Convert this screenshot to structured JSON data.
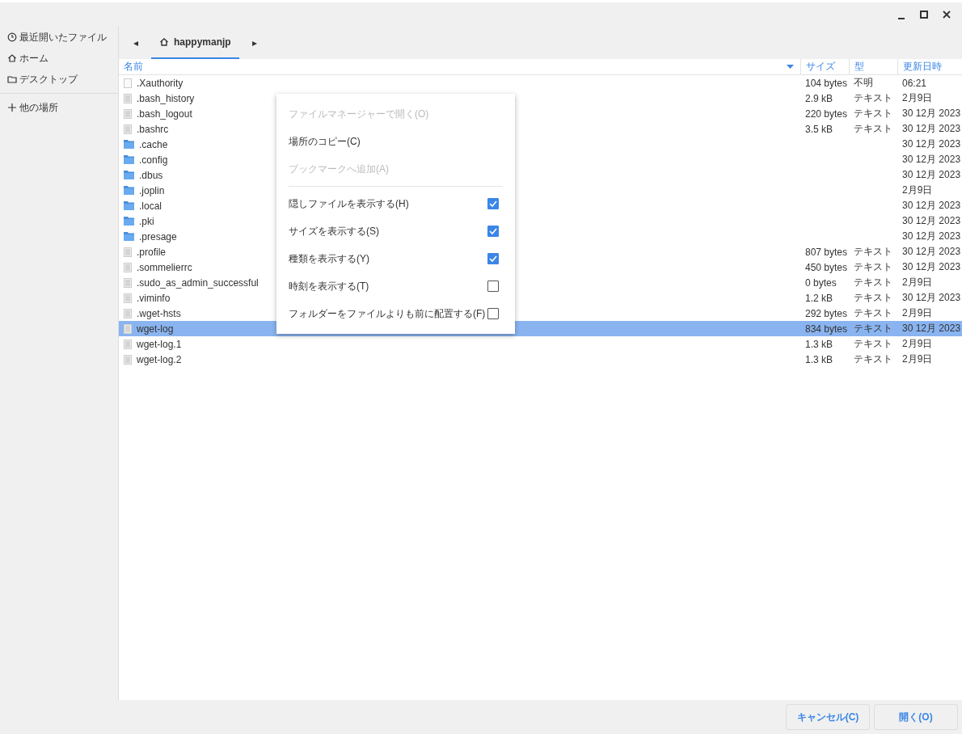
{
  "sidebar": {
    "items": [
      {
        "label": "最近開いたファイル",
        "selected": false
      },
      {
        "label": "ホーム",
        "selected": false
      },
      {
        "label": "デスクトップ",
        "selected": false
      }
    ],
    "other": {
      "label": "他の場所"
    }
  },
  "path_bar": {
    "back": "◂",
    "forward": "▸",
    "crumbs": [
      {
        "label": "happymanjp",
        "selected": true
      }
    ]
  },
  "table": {
    "columns": [
      "名前",
      "サイズ",
      "型",
      "更新日時"
    ],
    "rows": [
      {
        "kind": "unknown",
        "name": ".Xauthority",
        "size": "104 bytes",
        "type": "不明",
        "modified": "06:21",
        "selected": false
      },
      {
        "kind": "text",
        "name": ".bash_history",
        "size": "2.9 kB",
        "type": "テキスト",
        "modified": "2月9日",
        "selected": false
      },
      {
        "kind": "text",
        "name": ".bash_logout",
        "size": "220 bytes",
        "type": "テキスト",
        "modified": "30 12月 2023",
        "selected": false
      },
      {
        "kind": "text",
        "name": ".bashrc",
        "size": "3.5 kB",
        "type": "テキスト",
        "modified": "30 12月 2023",
        "selected": false
      },
      {
        "kind": "folder",
        "name": ".cache",
        "modified": "30 12月 2023",
        "selected": false
      },
      {
        "kind": "folder",
        "name": ".config",
        "modified": "30 12月 2023",
        "selected": false
      },
      {
        "kind": "folder",
        "name": ".dbus",
        "modified": "30 12月 2023",
        "selected": false
      },
      {
        "kind": "folder",
        "name": ".joplin",
        "modified": "2月9日",
        "selected": false
      },
      {
        "kind": "folder",
        "name": ".local",
        "modified": "30 12月 2023",
        "selected": false
      },
      {
        "kind": "folder",
        "name": ".pki",
        "modified": "30 12月 2023",
        "selected": false
      },
      {
        "kind": "folder",
        "name": ".presage",
        "modified": "30 12月 2023",
        "selected": false
      },
      {
        "kind": "text",
        "name": ".profile",
        "size": "807 bytes",
        "type": "テキスト",
        "modified": "30 12月 2023",
        "selected": false
      },
      {
        "kind": "text",
        "name": ".sommelierrc",
        "size": "450 bytes",
        "type": "テキスト",
        "modified": "30 12月 2023",
        "selected": false
      },
      {
        "kind": "text",
        "name": ".sudo_as_admin_successful",
        "size": "0 bytes",
        "type": "テキスト",
        "modified": "2月9日",
        "selected": false
      },
      {
        "kind": "text",
        "name": ".viminfo",
        "size": "1.2 kB",
        "type": "テキスト",
        "modified": "30 12月 2023",
        "selected": false
      },
      {
        "kind": "text",
        "name": ".wget-hsts",
        "size": "292 bytes",
        "type": "テキスト",
        "modified": "2月9日",
        "selected": false
      },
      {
        "kind": "text",
        "name": "wget-log",
        "size": "834 bytes",
        "type": "テキスト",
        "modified": "30 12月 2023",
        "selected": true
      },
      {
        "kind": "text",
        "name": "wget-log.1",
        "size": "1.3 kB",
        "type": "テキスト",
        "modified": "2月9日",
        "selected": false
      },
      {
        "kind": "text",
        "name": "wget-log.2",
        "size": "1.3 kB",
        "type": "テキスト",
        "modified": "2月9日",
        "selected": false
      }
    ]
  },
  "context_menu": {
    "items": [
      {
        "kind": "action",
        "label": "ファイルマネージャーで開く(O)",
        "disabled": true
      },
      {
        "kind": "action",
        "label": "場所のコピー(C)",
        "disabled": false
      },
      {
        "kind": "action",
        "label": "ブックマークへ追加(A)",
        "disabled": true
      },
      {
        "kind": "separator"
      },
      {
        "kind": "check",
        "label": "隠しファイルを表示する(H)",
        "checked": true
      },
      {
        "kind": "check",
        "label": "サイズを表示する(S)",
        "checked": true
      },
      {
        "kind": "check",
        "label": "種類を表示する(Y)",
        "checked": true
      },
      {
        "kind": "check",
        "label": "時刻を表示する(T)",
        "checked": false
      },
      {
        "kind": "check",
        "label": "フォルダーをファイルよりも前に配置する(F)",
        "checked": false
      }
    ]
  },
  "buttons": [
    {
      "label": "キャンセル(C)"
    },
    {
      "label": "開く(O)"
    }
  ]
}
